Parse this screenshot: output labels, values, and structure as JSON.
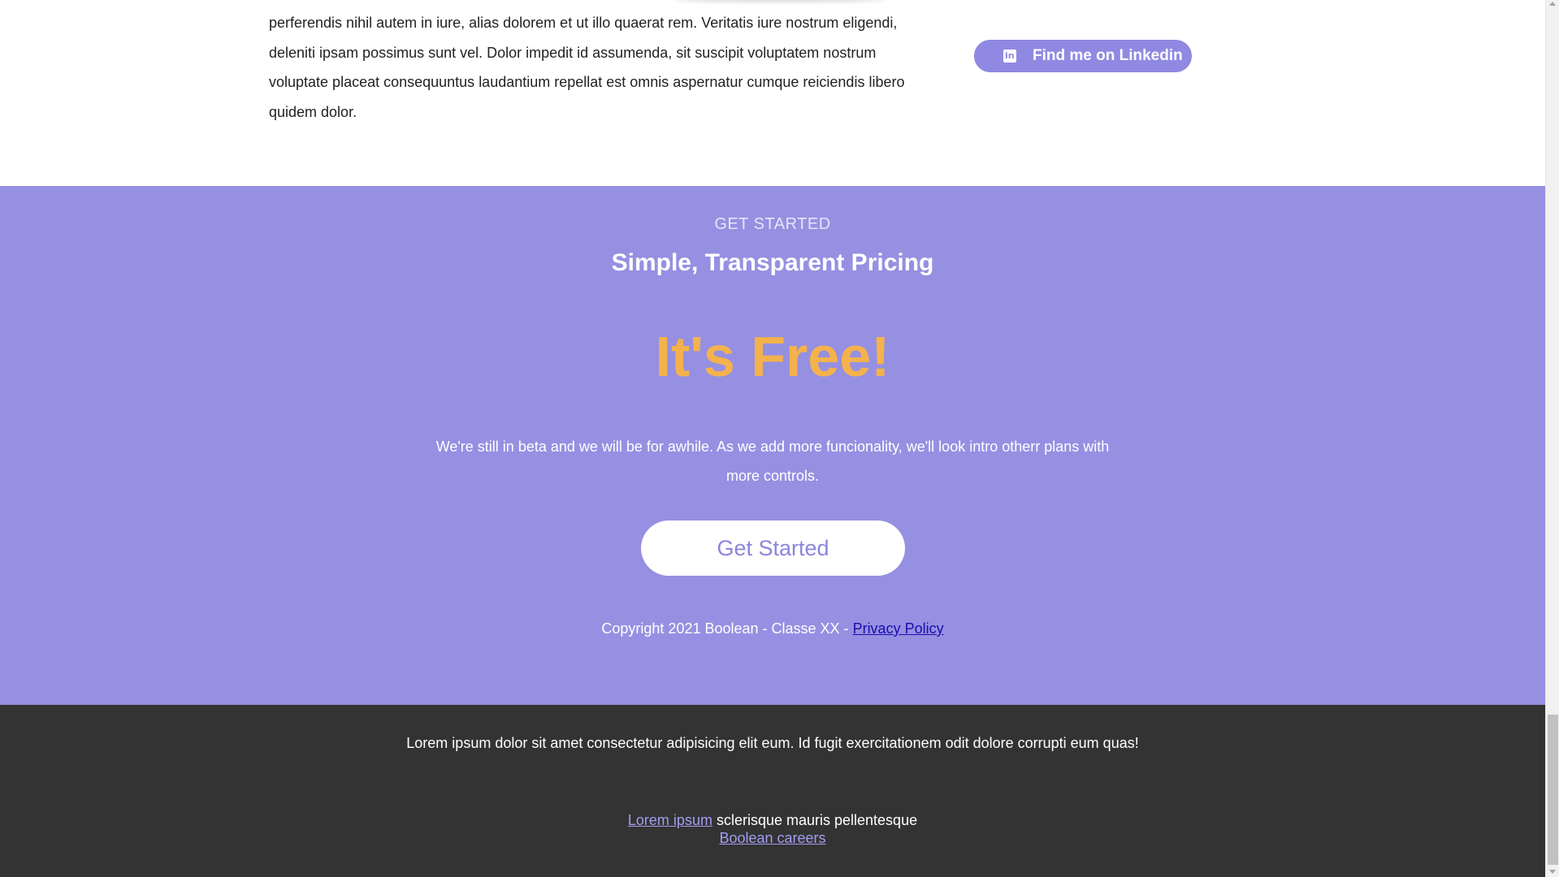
{
  "about": {
    "paragraph_lines": [
      "perferendis nihil autem in iure, alias dolorem et ut illo quaerat rem. Veritatis iure nostrum eligendi,",
      "deleniti ipsam possimus sunt vel. Dolor impedit id assumenda, sit suscipit voluptatem nostrum",
      "voluptate placeat consequuntus laudantium repellat est omnis aspernatur cumque reiciendis libero",
      "quidem dolor."
    ],
    "linkedin_icon_glyph": "in",
    "linkedin_label": "Find me on Linkedin"
  },
  "pricing": {
    "eyebrow": "GET STARTED",
    "title": "Simple, Transparent Pricing",
    "headline": "It's Free!",
    "description": "We're still in beta and we will be for awhile. As we add more funcionality, we'll look intro otherr plans with more controls.",
    "cta_label": "Get Started",
    "copyright_text": "Copyright 2021 Boolean - Classe XX - ",
    "privacy_link": "Privacy Policy"
  },
  "footer": {
    "text": "Lorem ipsum dolor sit amet consectetur adipisicing elit eum. Id fugit exercitationem odit dolore corrupti eum quas!",
    "link1": "Lorem ipsum",
    "link1_suffix": " sclerisque mauris pellentesque",
    "link2": "Boolean careers"
  },
  "colors": {
    "accent_purple": "#9690e2",
    "headline_orange": "#f4b24c",
    "footer_dark": "#333333"
  },
  "icons": {
    "linkedin": "linkedin-icon"
  }
}
